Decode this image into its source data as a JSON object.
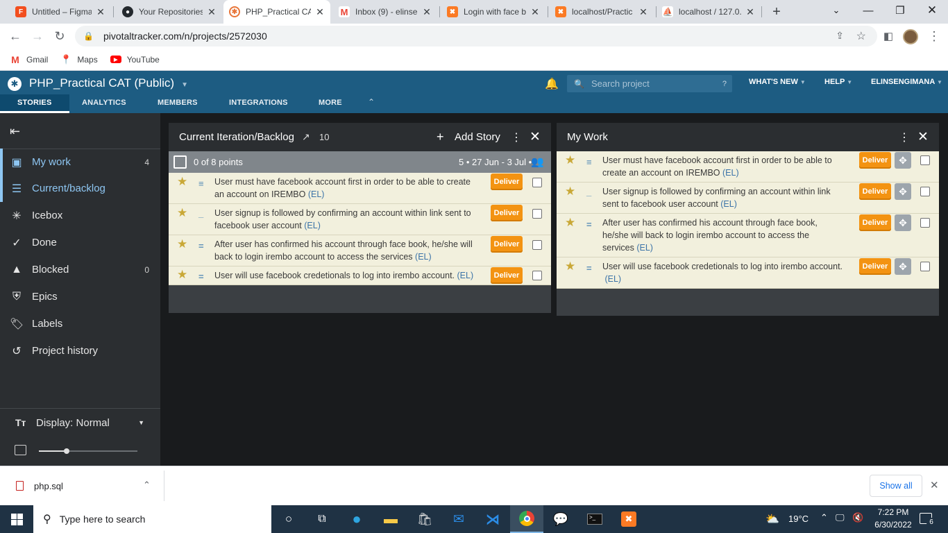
{
  "browser": {
    "tabs": [
      {
        "title": "Untitled – Figma",
        "icon": "figma-icon",
        "color": "#f24e1e"
      },
      {
        "title": "Your Repositories",
        "icon": "github-icon",
        "color": "#24292e"
      },
      {
        "title": "PHP_Practical CA",
        "icon": "pivotal-icon",
        "color": "#e8763a",
        "active": true
      },
      {
        "title": "Inbox (9) - elinse",
        "icon": "gmail-icon",
        "color": "#ea4335"
      },
      {
        "title": "Login with face b",
        "icon": "xampp-icon",
        "color": "#fb7a24"
      },
      {
        "title": "localhost/Practic",
        "icon": "xampp-icon",
        "color": "#fb7a24"
      },
      {
        "title": "localhost / 127.0.",
        "icon": "phpmyadmin-icon",
        "color": "#e8a521"
      }
    ],
    "new_tab": "+",
    "url": "pivotaltracker.com/n/projects/2572030",
    "bookmarks": [
      {
        "label": "Gmail",
        "icon": "gmail-icon",
        "color": "#ea4335"
      },
      {
        "label": "Maps",
        "icon": "maps-icon",
        "color": "#34a853"
      },
      {
        "label": "YouTube",
        "icon": "youtube-icon",
        "color": "#ff0000"
      }
    ]
  },
  "project": {
    "title": "PHP_Practical CAT (Public)",
    "nav": [
      "STORIES",
      "ANALYTICS",
      "MEMBERS",
      "INTEGRATIONS",
      "MORE"
    ],
    "search_placeholder": "Search project",
    "search_help": "?",
    "whats_new": "WHAT'S NEW",
    "help": "HELP",
    "user": "ELINSENGIMANA"
  },
  "sidebar": {
    "items": [
      {
        "label": "My work",
        "count": "4",
        "icon": "my-work-icon"
      },
      {
        "label": "Current/backlog",
        "count": "",
        "icon": "list-icon"
      },
      {
        "label": "Icebox",
        "count": "",
        "icon": "snowflake-icon"
      },
      {
        "label": "Done",
        "count": "",
        "icon": "check-icon"
      },
      {
        "label": "Blocked",
        "count": "0",
        "icon": "warning-icon"
      },
      {
        "label": "Epics",
        "count": "",
        "icon": "shield-icon"
      },
      {
        "label": "Labels",
        "count": "",
        "icon": "tag-icon"
      },
      {
        "label": "Project history",
        "count": "",
        "icon": "history-icon"
      }
    ],
    "display_label": "Display: Normal",
    "zoom_level": 0.28
  },
  "backlog": {
    "title": "Current Iteration/Backlog",
    "velocity": "10",
    "add_story": "Add Story",
    "iteration_points": "0 of 8 points",
    "iteration_info": "5 • 27 Jun - 3 Jul •",
    "stories": [
      {
        "line1": "User must have facebook account first in order to be able to create",
        "line2": "an account on IREMBO",
        "owner": "(EL)",
        "estimate": "≡",
        "action": "Deliver"
      },
      {
        "line1": "User signup is followed by confirming an account within link sent to",
        "line2": "facebook user account",
        "owner": "(EL)",
        "estimate": "_",
        "action": "Deliver"
      },
      {
        "line1": "After user has confirmed his account through face book, he/she will",
        "line2": "back to login irembo account to access the services",
        "owner": "(EL)",
        "estimate": "=",
        "action": "Deliver"
      },
      {
        "line1": "User will use facebook credetionals to log into irembo account.",
        "line2": "",
        "owner": "(EL)",
        "estimate": "=",
        "action": "Deliver"
      }
    ]
  },
  "mywork": {
    "title": "My Work",
    "stories": [
      {
        "line1": "User must have facebook account first in order to be able to",
        "line2": "create an account on IREMBO",
        "line3": "",
        "owner": "(EL)",
        "estimate": "≡",
        "action": "Deliver"
      },
      {
        "line1": "User signup is followed by confirming an account within link",
        "line2": "sent to facebook user account",
        "line3": "",
        "owner": "(EL)",
        "estimate": "_",
        "action": "Deliver"
      },
      {
        "line1": "After user has confirmed his account through face book,",
        "line2": "he/she will back to login irembo account to access the",
        "line3": "services",
        "owner": "(EL)",
        "estimate": "=",
        "action": "Deliver"
      },
      {
        "line1": "User will use facebook credetionals to log into irembo account.",
        "line2": "",
        "line3": "",
        "owner": "(EL)",
        "estimate": "=",
        "action": "Deliver"
      }
    ]
  },
  "downloads": {
    "file": "php.sql",
    "show_all": "Show all"
  },
  "taskbar": {
    "search_placeholder": "Type here to search",
    "temperature": "19°C",
    "time": "7:22 PM",
    "date": "6/30/2022",
    "notifications": "6"
  }
}
